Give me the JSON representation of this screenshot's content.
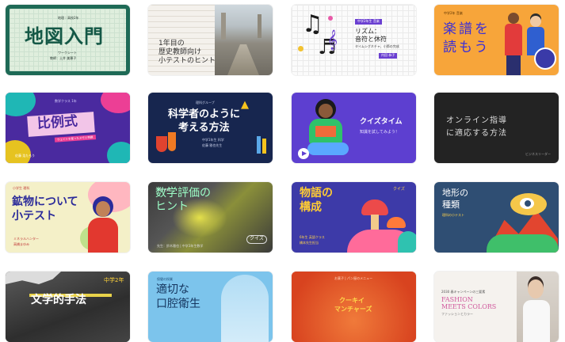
{
  "templates": [
    {
      "title": "地図入門",
      "subtitle": "社会科",
      "meta_lines": [
        "地理｜高校2年",
        "ワークシート",
        "教師：土井 美穂子"
      ]
    },
    {
      "title": "1年目の歴史教師向け小テストのヒント",
      "title_lines": [
        "1年目の",
        "歴史教師向け",
        "小テストのヒント"
      ]
    },
    {
      "title": "リズム：音符と休符",
      "title_lines": [
        "リズム：",
        "音符と休符"
      ],
      "tag": "中学2年生 音楽",
      "meta": "タイムシグネチャ、小節の完成",
      "tag2": "内田 恭子"
    },
    {
      "title": "楽譜を読もう",
      "title_lines": [
        "楽譜を",
        "読もう"
      ],
      "meta": "中学2年 音楽"
    },
    {
      "title": "比例式",
      "meta": "数学クラス 1年",
      "subtitle": "ウェイトを使ったメモと例題",
      "footer": "佐藤 浩たろう"
    },
    {
      "title": "科学者のように考える方法",
      "title_lines": [
        "科学者のように",
        "考える方法"
      ],
      "meta": "理科グループ",
      "sub": "中学1年生 科学",
      "author": "佐藤 雅也先生"
    },
    {
      "title": "クイズタイム",
      "subtitle": "知識を試してみよう！"
    },
    {
      "title": "オンライン指導に適応する方法",
      "title_lines": [
        "オンライン指導",
        "に適応する方法"
      ],
      "footer": "ビジネスリーダー"
    },
    {
      "title": "鉱物について小テスト",
      "title_lines": [
        "鉱物について",
        "小テスト"
      ],
      "tag": "小学生 理科",
      "meta": "ミネラルハンター",
      "footer": "高橋まゆみ"
    },
    {
      "title": "数学評価のヒント",
      "title_lines": [
        "数学評価の",
        "ヒント"
      ],
      "meta": "学校 名前",
      "badge": "クイズ",
      "footer": "先生：鈴木雅也 | 中学3年生数学"
    },
    {
      "title": "物語の構成",
      "title_lines": [
        "物語の",
        "構成"
      ],
      "tag": "クイズ",
      "meta_lines": [
        "6年生 英語クラス",
        "橋本先生担当"
      ]
    },
    {
      "title": "地形の種類",
      "title_lines": [
        "地形の",
        "種類"
      ],
      "meta": "理科の小テスト"
    },
    {
      "title": "文学的手法",
      "tag": "中学2年"
    },
    {
      "title": "適切な口腔衛生",
      "title_lines": [
        "適切な",
        "口腔衛生"
      ],
      "meta": "保健の授業"
    },
    {
      "title": "クーキイ マンチャーズ",
      "title_lines": [
        "クーキイ",
        "マンチャーズ"
      ],
      "meta": "お菓子 | パン屋のメニュー"
    },
    {
      "title": "FASHION MEETS COLORS",
      "title_lines": [
        "FASHION",
        "MEETS COLORS"
      ],
      "meta": "2030 春キャンペーンの三要素",
      "sub": "ファッションとカラー"
    }
  ]
}
